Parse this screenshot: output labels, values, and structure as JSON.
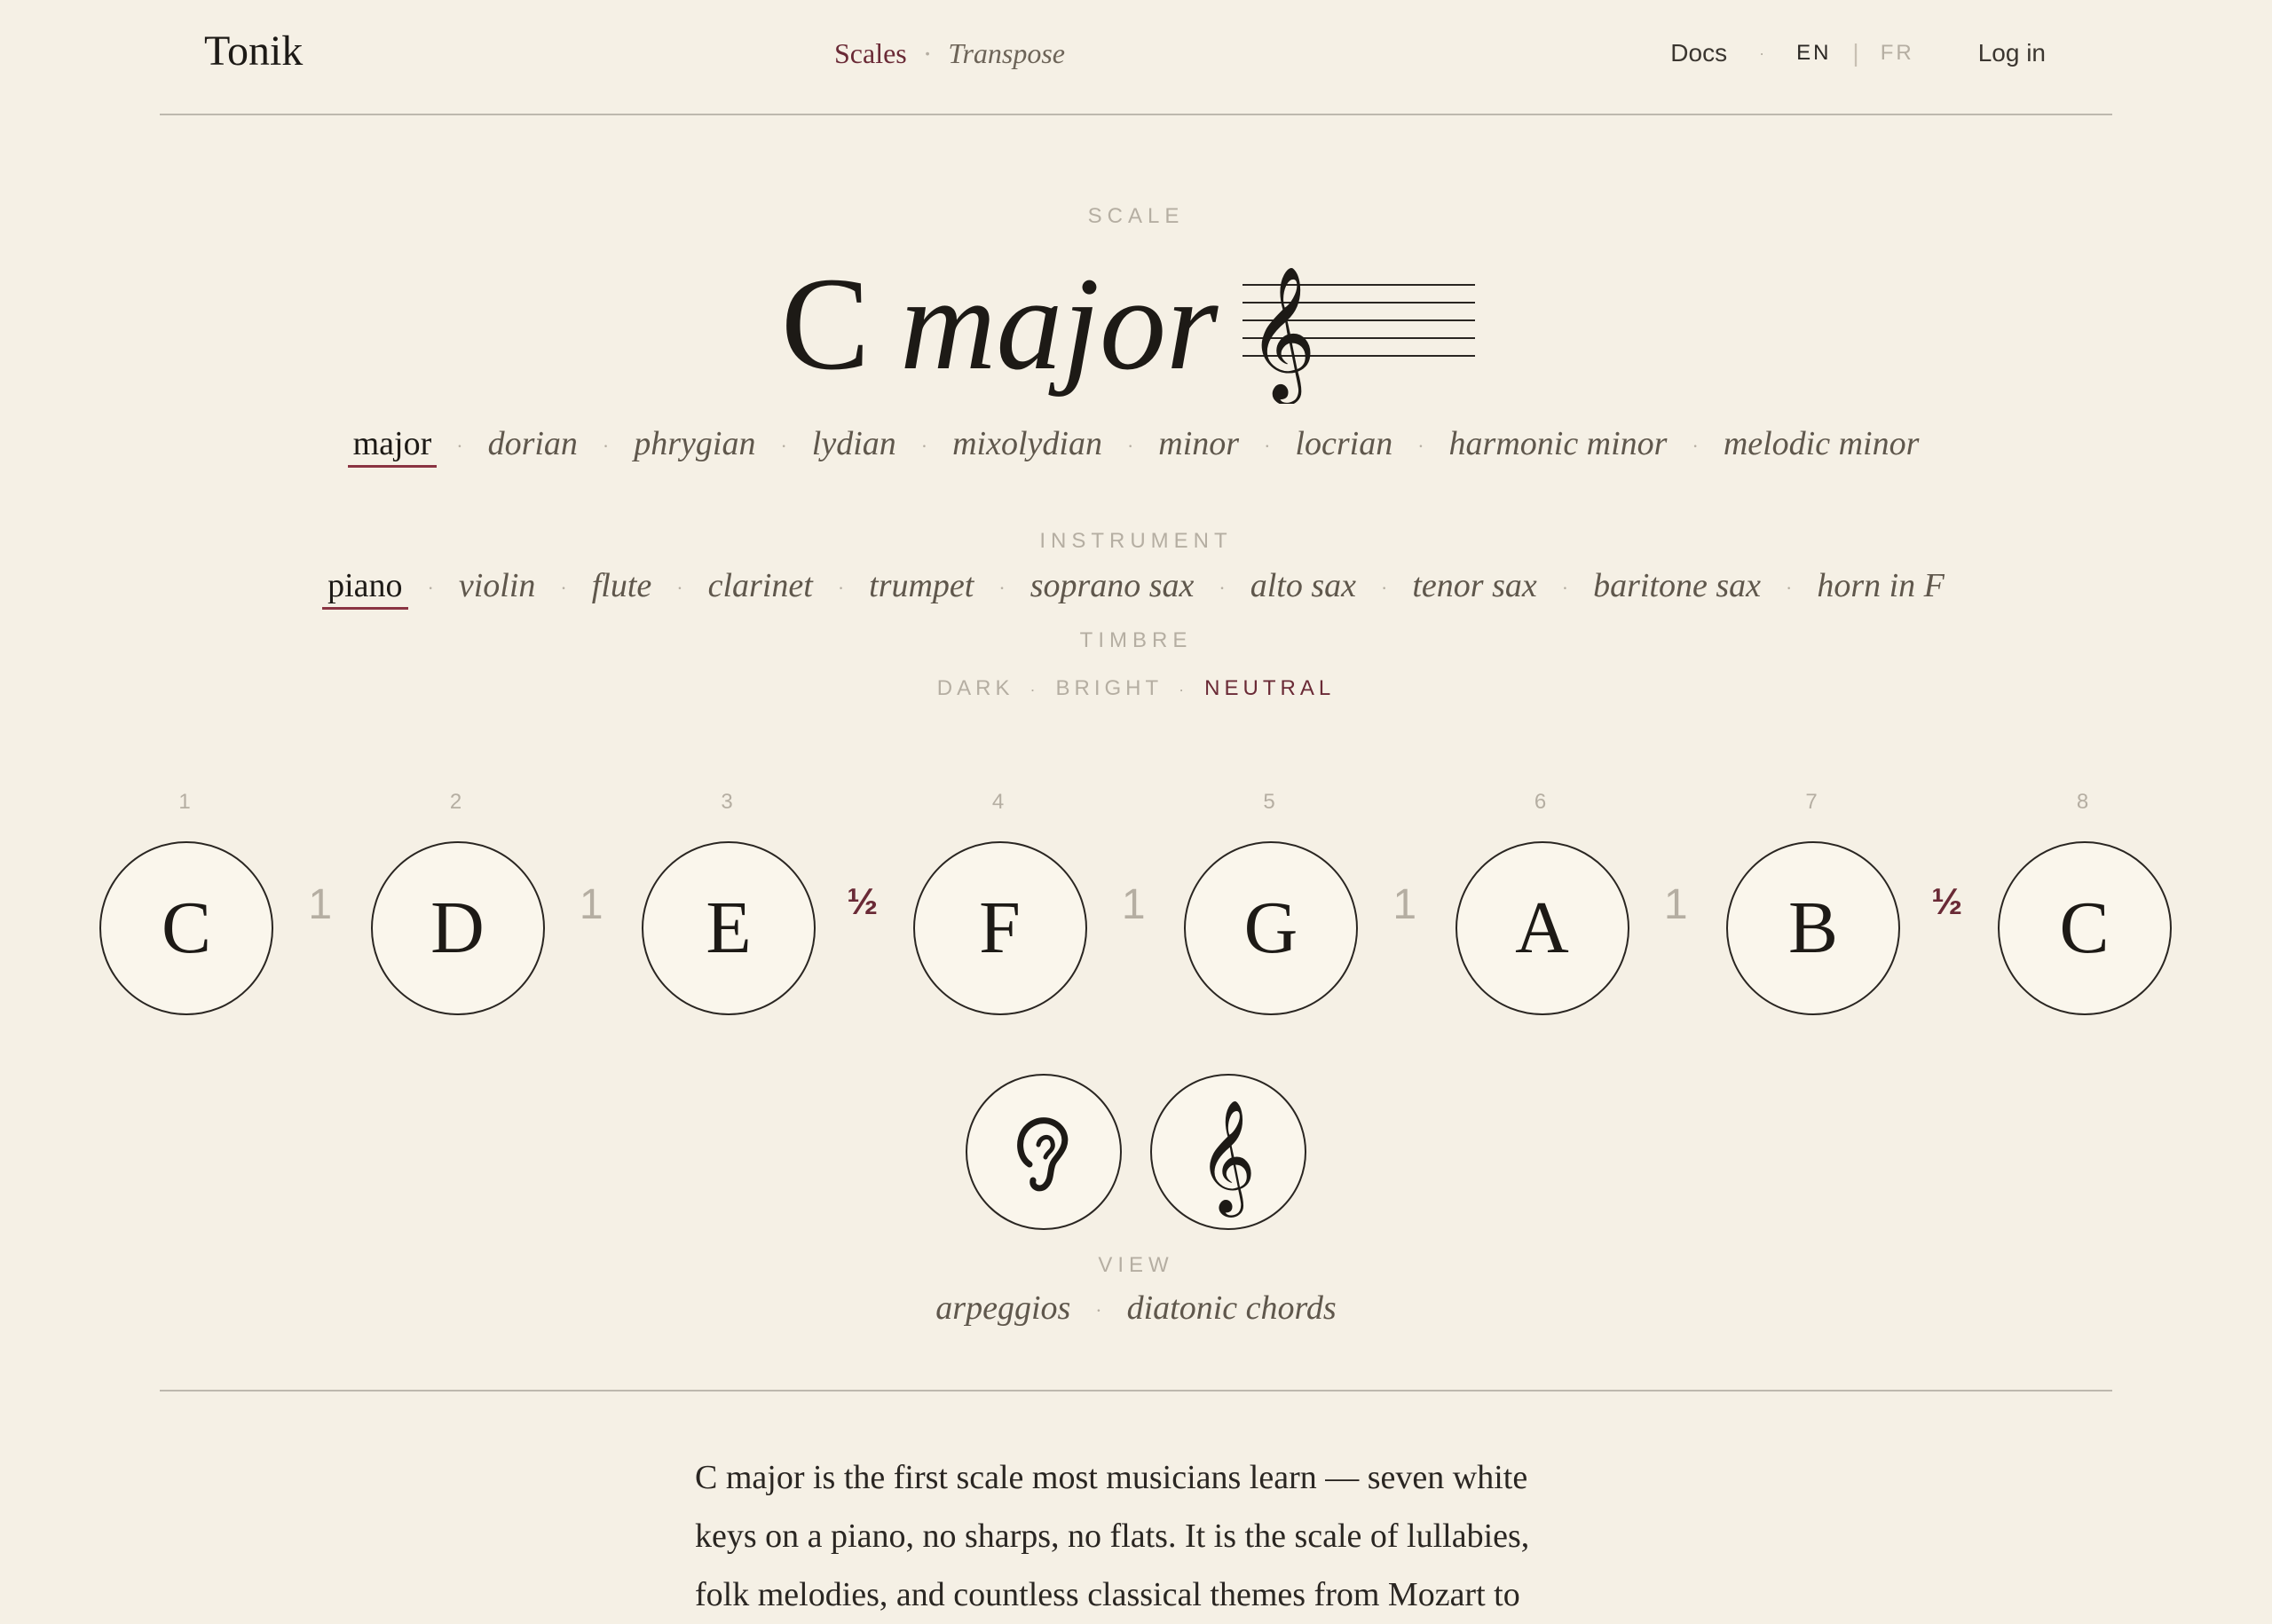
{
  "header": {
    "brand": "Tonik",
    "nav": {
      "scales": "Scales",
      "dot": "·",
      "transpose": "Transpose"
    },
    "docs": "Docs",
    "dot": "·",
    "lang_en": "EN",
    "lang_sep": "|",
    "lang_fr": "FR",
    "login": "Log in"
  },
  "scale": {
    "label": "SCALE",
    "root": "C",
    "mode": "major",
    "modes": [
      "major",
      "dorian",
      "phrygian",
      "lydian",
      "mixolydian",
      "minor",
      "locrian",
      "harmonic minor",
      "melodic minor"
    ],
    "active_mode": "major"
  },
  "instrument": {
    "label": "INSTRUMENT",
    "items": [
      "piano",
      "violin",
      "flute",
      "clarinet",
      "trumpet",
      "soprano sax",
      "alto sax",
      "tenor sax",
      "baritone sax",
      "horn in F"
    ],
    "active": "piano"
  },
  "timbre": {
    "label": "TIMBRE",
    "items": [
      "DARK",
      "BRIGHT",
      "NEUTRAL"
    ],
    "active": "NEUTRAL"
  },
  "notes": {
    "degrees": [
      "1",
      "2",
      "3",
      "4",
      "5",
      "6",
      "7",
      "8"
    ],
    "names": [
      "C",
      "D",
      "E",
      "F",
      "G",
      "A",
      "B",
      "C"
    ],
    "steps": [
      "1",
      "1",
      "½",
      "1",
      "1",
      "1",
      "½"
    ]
  },
  "actions": {
    "listen_icon": "ear-icon",
    "notation_icon": "treble-clef-icon"
  },
  "view": {
    "label": "VIEW",
    "items": [
      "arpeggios",
      "diatonic chords"
    ]
  },
  "description": "C major is the first scale most musicians learn — seven white keys on a piano, no sharps, no flats. It is the scale of lullabies, folk melodies, and countless classical themes from Mozart to",
  "colors": {
    "background": "#f5f0e5",
    "accent": "#6a2a36",
    "muted": "#b5aea2"
  }
}
